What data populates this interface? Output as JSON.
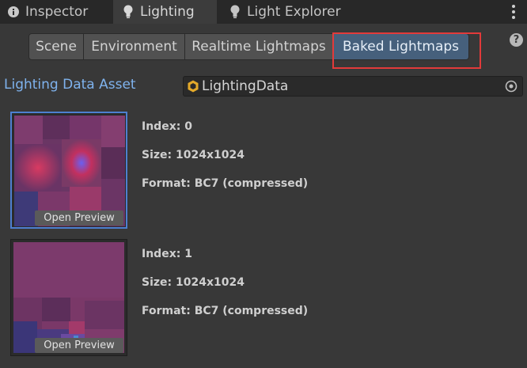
{
  "tabs": [
    {
      "label": "Inspector",
      "icon": "info-icon"
    },
    {
      "label": "Lighting",
      "icon": "lightbulb-icon"
    },
    {
      "label": "Light Explorer",
      "icon": "lightbulb-icon"
    }
  ],
  "toolbar": {
    "segments": [
      "Scene",
      "Environment",
      "Realtime Lightmaps",
      "Baked Lightmaps"
    ],
    "selected": "Baked Lightmaps"
  },
  "help_icon": "?",
  "asset": {
    "label": "Lighting Data Asset",
    "value": "LightingData"
  },
  "lightmaps": [
    {
      "index": "Index: 0",
      "size": "Size: 1024x1024",
      "format": "Format: BC7 (compressed)",
      "button": "Open Preview"
    },
    {
      "index": "Index: 1",
      "size": "Size: 1024x1024",
      "format": "Format: BC7 (compressed)",
      "button": "Open Preview"
    }
  ],
  "colors": {
    "background": "#383838",
    "selected_segment": "#46607c",
    "highlight": "#e23a3a",
    "asset_label": "#7fb3ee"
  }
}
